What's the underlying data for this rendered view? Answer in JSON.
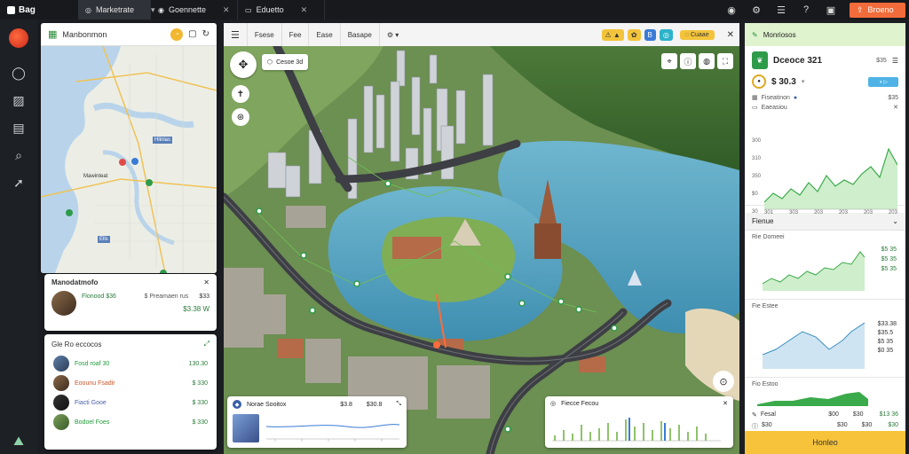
{
  "topbar": {
    "app_name": "Bag",
    "tabs": [
      {
        "label": "Marketrate",
        "active": true
      },
      {
        "label": "Goennette",
        "active": false
      },
      {
        "label": "Eduetto",
        "active": false
      }
    ],
    "action_button": "Broeno"
  },
  "left_map": {
    "title": "Manbonmon",
    "label_water": "Hlinlas",
    "label_city": "Mawinteat",
    "label_small": "Ells"
  },
  "summary_card": {
    "title": "Manodatmofo",
    "row_name": "Flonood  $36",
    "row_detail": "$ Preamaen rus",
    "row_value": "$33",
    "row_total": "$3.38 W"
  },
  "list_card": {
    "title": "Gle Ro eccocos",
    "items": [
      {
        "name": "Fosd roaf  30",
        "value": "130.30"
      },
      {
        "name": "Eoounu Fsadir",
        "value": "$ 330"
      },
      {
        "name": "Fiacti  Gooe",
        "value": "$ 330"
      },
      {
        "name": "Bodoel Foes",
        "value": "$ 330"
      }
    ]
  },
  "toolbar3d": {
    "items": [
      "Fsese",
      "Fee",
      "Ease",
      "Basape"
    ],
    "dropdown": "",
    "badge_label": "Cuaae"
  },
  "map3d": {
    "overlay_label": "Cesoe 3d",
    "bottom_left_title": "Norae Sooitox",
    "bottom_left_v1": "$3.8",
    "bottom_left_v2": "$30.8",
    "bottom_right_title": "Fiecce  Fecou"
  },
  "right_panel": {
    "header": "Monriosos",
    "stat_title": "Dceoce 321",
    "stat_sub": "$35",
    "stat_value": "$ 30.3",
    "line_label": "Fiseatinon",
    "line_label2": "Eaeasiou",
    "line_value": "$35",
    "chart1_yticks": [
      "300",
      "310",
      "350",
      "$0",
      "30"
    ],
    "chart1_xticks": [
      "301",
      "303",
      "203",
      "203",
      "203",
      "203"
    ],
    "section2_title": "Fienue",
    "chart2_label": "Rie Domeei",
    "chart2_values": [
      "$5 35",
      "$5 35",
      "$5 35"
    ],
    "chart3_label": "Fie  Estee",
    "chart3_values": [
      "$33.38",
      "$35.5",
      "$5 35",
      "$0 35"
    ],
    "chart4_label": "Fio  Estoo",
    "chart4_rows": [
      {
        "label": "Fesal",
        "v1": "$00",
        "v2": "$30",
        "v3": "$13 36"
      },
      {
        "label": "$30",
        "v1": "$30",
        "v2": "$30",
        "v3": "$30"
      }
    ],
    "footer_button": "Honleo"
  }
}
